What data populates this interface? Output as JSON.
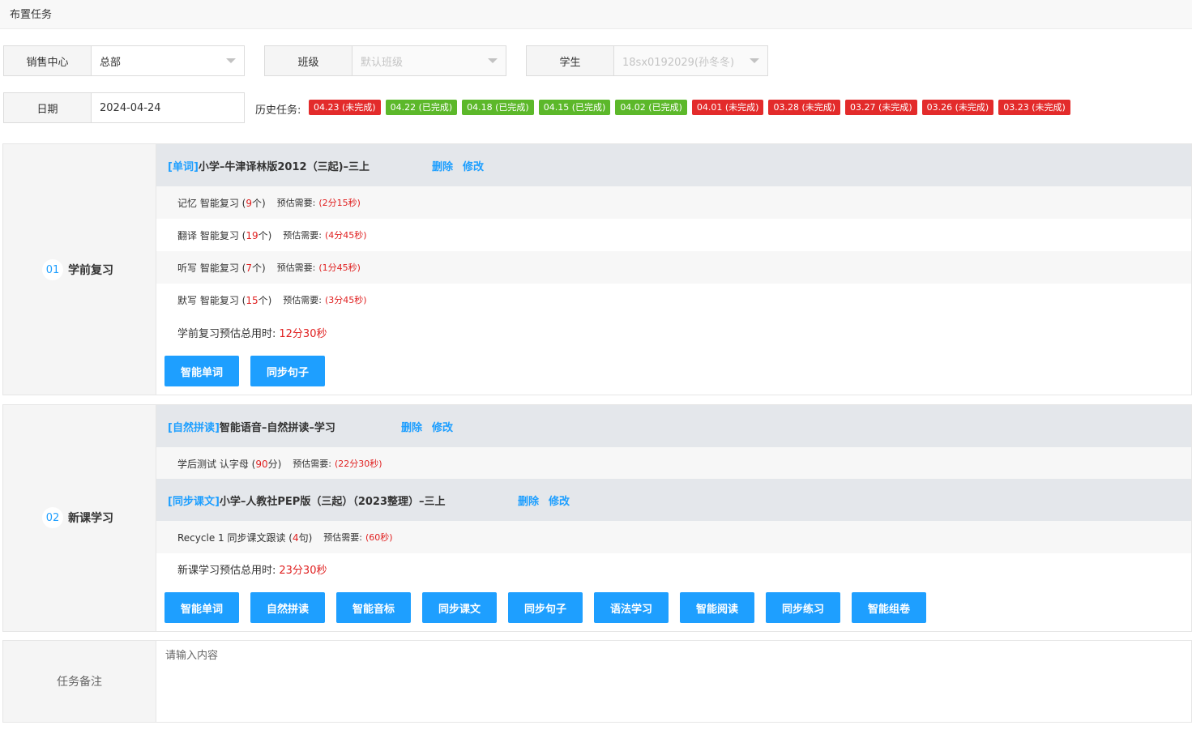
{
  "page": {
    "title": "布置任务"
  },
  "filters": {
    "sales_center": {
      "label": "销售中心",
      "value": "总部"
    },
    "class": {
      "label": "班级",
      "value": "默认班级"
    },
    "student": {
      "label": "学生",
      "value": "18sx0192029(孙冬冬)"
    },
    "date": {
      "label": "日期",
      "value": "2024-04-24"
    }
  },
  "history": {
    "label": "历史任务:",
    "tags": [
      {
        "text": "04.23 (未完成)",
        "status": "incomplete"
      },
      {
        "text": "04.22 (已完成)",
        "status": "complete"
      },
      {
        "text": "04.18 (已完成)",
        "status": "complete"
      },
      {
        "text": "04.15 (已完成)",
        "status": "complete"
      },
      {
        "text": "04.02 (已完成)",
        "status": "complete"
      },
      {
        "text": "04.01 (未完成)",
        "status": "incomplete"
      },
      {
        "text": "03.28 (未完成)",
        "status": "incomplete"
      },
      {
        "text": "03.27 (未完成)",
        "status": "incomplete"
      },
      {
        "text": "03.26 (未完成)",
        "status": "incomplete"
      },
      {
        "text": "03.23 (未完成)",
        "status": "incomplete"
      }
    ]
  },
  "colors": {
    "accent": "#1e9fff",
    "complete": "#5cb82a",
    "incomplete": "#e32b2b",
    "highlight": "#e02020"
  },
  "section1": {
    "num": "01",
    "name": "学前复习",
    "course": {
      "tag": "[单词]",
      "title": "小学–牛津译林版2012（三起)–三上",
      "delete": "删除",
      "edit": "修改"
    },
    "rows": [
      {
        "a": "记忆 智能复习 (",
        "n": "9",
        "b": "个)",
        "est_label": "预估需要:",
        "est": "(2分15秒)"
      },
      {
        "a": "翻译 智能复习 (",
        "n": "19",
        "b": "个)",
        "est_label": "预估需要:",
        "est": "(4分45秒)"
      },
      {
        "a": "听写 智能复习 (",
        "n": "7",
        "b": "个)",
        "est_label": "预估需要:",
        "est": "(1分45秒)"
      },
      {
        "a": "默写 智能复习 (",
        "n": "15",
        "b": "个)",
        "est_label": "预估需要:",
        "est": "(3分45秒)"
      }
    ],
    "total_label": "学前复习预估总用时:",
    "total_value": "12分30秒",
    "buttons": [
      "智能单词",
      "同步句子"
    ]
  },
  "section2": {
    "num": "02",
    "name": "新课学习",
    "course1": {
      "tag": "[自然拼读]",
      "title": "智能语音–自然拼读–学习",
      "delete": "删除",
      "edit": "修改"
    },
    "row1": {
      "a": "学后测试 认字母 (",
      "n": "90",
      "b": "分)",
      "est_label": "预估需要:",
      "est": "(22分30秒)"
    },
    "course2": {
      "tag": "[同步课文]",
      "title": "小学–人教社PEP版（三起）（2023整理）–三上",
      "delete": "删除",
      "edit": "修改"
    },
    "row2": {
      "a": "Recycle 1 同步课文跟读 (",
      "n": "4",
      "b": "句)",
      "est_label": "预估需要:",
      "est": "(60秒)"
    },
    "total_label": "新课学习预估总用时:",
    "total_value": "23分30秒",
    "buttons": [
      "智能单词",
      "自然拼读",
      "智能音标",
      "同步课文",
      "同步句子",
      "语法学习",
      "智能阅读",
      "同步练习",
      "智能组卷"
    ]
  },
  "note": {
    "label": "任务备注",
    "placeholder": "请输入内容"
  }
}
